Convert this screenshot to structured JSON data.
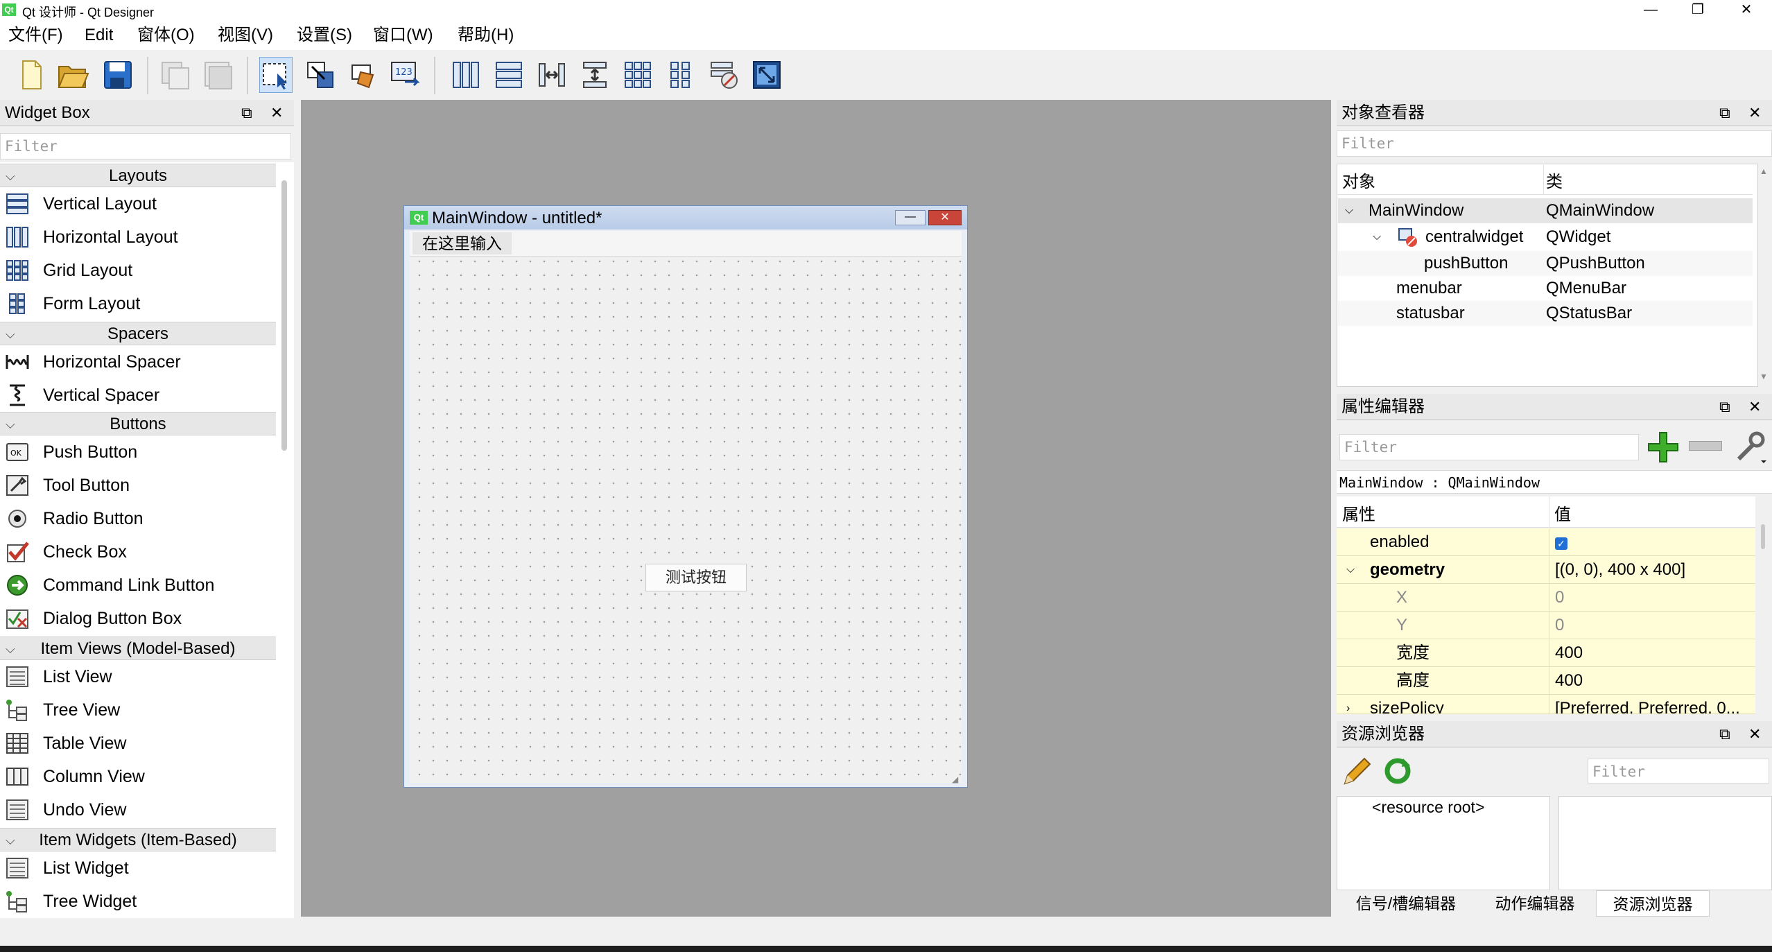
{
  "window": {
    "title": "Qt 设计师 - Qt Designer",
    "logo_text": "Qt",
    "controls": [
      "—",
      "❐",
      "✕"
    ]
  },
  "menubar": [
    "文件(F)",
    "Edit",
    "窗体(O)",
    "视图(V)",
    "设置(S)",
    "窗口(W)",
    "帮助(H)"
  ],
  "toolbar": {
    "icons": [
      "new-file-icon",
      "open-folder-icon",
      "save-icon",
      "copy-icon",
      "paste-icon",
      "edit-widgets-icon",
      "edit-signals-slots-icon",
      "edit-buddies-icon",
      "edit-tab-order-icon",
      "layout-horizontal-icon",
      "layout-vertical-icon",
      "layout-horizontal-splitter-icon",
      "layout-vertical-splitter-icon",
      "layout-grid-icon",
      "layout-form-icon",
      "break-layout-icon",
      "adjust-size-icon"
    ]
  },
  "widget_box": {
    "title": "Widget Box",
    "filter_placeholder": "Filter",
    "categories": [
      {
        "name": "Layouts",
        "items": [
          "Vertical Layout",
          "Horizontal Layout",
          "Grid Layout",
          "Form Layout"
        ]
      },
      {
        "name": "Spacers",
        "items": [
          "Horizontal Spacer",
          "Vertical Spacer"
        ]
      },
      {
        "name": "Buttons",
        "items": [
          "Push Button",
          "Tool Button",
          "Radio Button",
          "Check Box",
          "Command Link Button",
          "Dialog Button Box"
        ]
      },
      {
        "name": "Item Views (Model-Based)",
        "items": [
          "List View",
          "Tree View",
          "Table View",
          "Column View",
          "Undo View"
        ]
      },
      {
        "name": "Item Widgets (Item-Based)",
        "items": [
          "List Widget",
          "Tree Widget"
        ]
      }
    ]
  },
  "form": {
    "title": "MainWindow - untitled*",
    "logo_text": "Qt",
    "menu_placeholder": "在这里输入",
    "button_label": "测试按钮"
  },
  "object_inspector": {
    "title": "对象查看器",
    "filter_placeholder": "Filter",
    "col_object": "对象",
    "col_class": "类",
    "rows": [
      {
        "object": "MainWindow",
        "class": "QMainWindow"
      },
      {
        "object": "centralwidget",
        "class": "QWidget"
      },
      {
        "object": "pushButton",
        "class": "QPushButton"
      },
      {
        "object": "menubar",
        "class": "QMenuBar"
      },
      {
        "object": "statusbar",
        "class": "QStatusBar"
      }
    ]
  },
  "property_editor": {
    "title": "属性编辑器",
    "filter_placeholder": "Filter",
    "context": "MainWindow : QMainWindow",
    "col_property": "属性",
    "col_value": "值",
    "rows": [
      {
        "name": "enabled",
        "value": ""
      },
      {
        "name": "geometry",
        "value": "[(0, 0), 400 x 400]"
      },
      {
        "name": "X",
        "value": "0"
      },
      {
        "name": "Y",
        "value": "0"
      },
      {
        "name": "宽度",
        "value": "400"
      },
      {
        "name": "高度",
        "value": "400"
      },
      {
        "name": "sizePolicy",
        "value": "[Preferred, Preferred, 0..."
      }
    ]
  },
  "resource_browser": {
    "title": "资源浏览器",
    "filter_placeholder": "Filter",
    "root": "<resource root>"
  },
  "bottom_tabs": [
    "信号/槽编辑器",
    "动作编辑器",
    "资源浏览器"
  ],
  "colors": {
    "canvas": "#a0a0a0",
    "property_row": "#fffcd8",
    "form_title": "#b8cbe7"
  }
}
